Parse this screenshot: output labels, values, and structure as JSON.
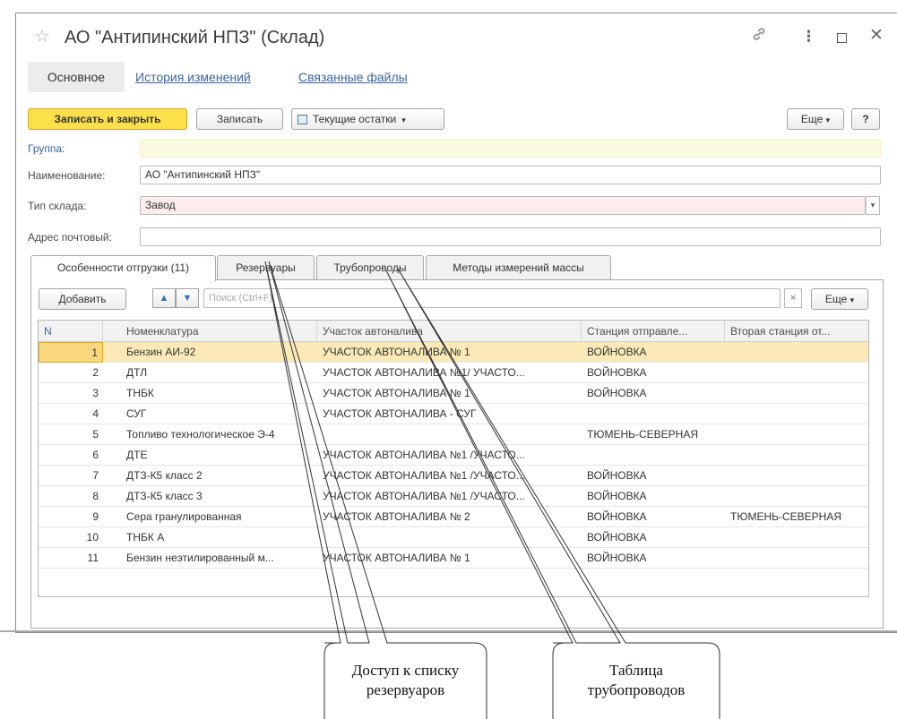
{
  "window": {
    "title": "АО \"Антипинский НПЗ\" (Склад)"
  },
  "icons": {
    "favorite": "star-icon",
    "link": "link-icon",
    "more": "more-icon",
    "maximize": "maximize-icon",
    "close": "close-icon"
  },
  "nav": {
    "main": "Основное",
    "history": "История изменений",
    "files": "Связанные файлы"
  },
  "toolbar": {
    "save_close": "Записать и закрыть",
    "save": "Записать",
    "balances": "Текущие остатки",
    "more": "Еще",
    "help": "?"
  },
  "form": {
    "group_label": "Группа:",
    "name_label": "Наименование:",
    "name_value": "АО \"Антипинский НПЗ\"",
    "type_label": "Тип склада:",
    "type_value": "Завод",
    "address_label": "Адрес почтовый:",
    "address_value": ""
  },
  "tabs": [
    {
      "label": "Особенности отгрузки (11)"
    },
    {
      "label": "Резервуары"
    },
    {
      "label": "Трубопроводы"
    },
    {
      "label": "Методы измерений массы"
    }
  ],
  "table_toolbar": {
    "add": "Добавить",
    "search_placeholder": "Поиск (Ctrl+F)",
    "clear": "×",
    "more": "Еще"
  },
  "table": {
    "columns": [
      "N",
      "Номенклатура",
      "Участок автоналива",
      "Станция отправле...",
      "Вторая станция от..."
    ],
    "rows": [
      {
        "n": "1",
        "item": "Бензин АИ-92",
        "area": "УЧАСТОК АВТОНАЛИВА № 1",
        "station": "ВОЙНОВКА",
        "station2": ""
      },
      {
        "n": "2",
        "item": "ДТЛ",
        "area": "УЧАСТОК АВТОНАЛИВА №1/ УЧАСТО...",
        "station": "ВОЙНОВКА",
        "station2": ""
      },
      {
        "n": "3",
        "item": "ТНБК",
        "area": "УЧАСТОК АВТОНАЛИВА № 1",
        "station": "ВОЙНОВКА",
        "station2": ""
      },
      {
        "n": "4",
        "item": "СУГ",
        "area": "УЧАСТОК АВТОНАЛИВА - СУГ",
        "station": "",
        "station2": ""
      },
      {
        "n": "5",
        "item": "Топливо технологическое Э-4",
        "area": "",
        "station": "ТЮМЕНЬ-СЕВЕРНАЯ",
        "station2": ""
      },
      {
        "n": "6",
        "item": "ДТЕ",
        "area": "УЧАСТОК АВТОНАЛИВА №1 /УЧАСТО...",
        "station": "",
        "station2": ""
      },
      {
        "n": "7",
        "item": "ДТЗ-К5 класс 2",
        "area": "УЧАСТОК АВТОНАЛИВА №1 /УЧАСТО...",
        "station": "ВОЙНОВКА",
        "station2": ""
      },
      {
        "n": "8",
        "item": "ДТЗ-К5 класс 3",
        "area": "УЧАСТОК АВТОНАЛИВА №1 /УЧАСТО...",
        "station": "ВОЙНОВКА",
        "station2": ""
      },
      {
        "n": "9",
        "item": "Сера гранулированная",
        "area": "УЧАСТОК АВТОНАЛИВА № 2",
        "station": "ВОЙНОВКА",
        "station2": "ТЮМЕНЬ-СЕВЕРНАЯ"
      },
      {
        "n": "10",
        "item": "ТНБК А",
        "area": "",
        "station": "ВОЙНОВКА",
        "station2": ""
      },
      {
        "n": "11",
        "item": "Бензин неэтилированный м...",
        "area": "УЧАСТОК АВТОНАЛИВА № 1",
        "station": "ВОЙНОВКА",
        "station2": ""
      }
    ]
  },
  "callouts": {
    "reservoirs": [
      "Доступ к списку",
      "резервуаров"
    ],
    "pipelines": [
      "Таблица",
      "трубопроводов"
    ]
  },
  "colors": {
    "primary_button": "#fbe04a",
    "link": "#3a63a6",
    "selected_row": "#fbeab7",
    "required_field": "#fcecec"
  }
}
